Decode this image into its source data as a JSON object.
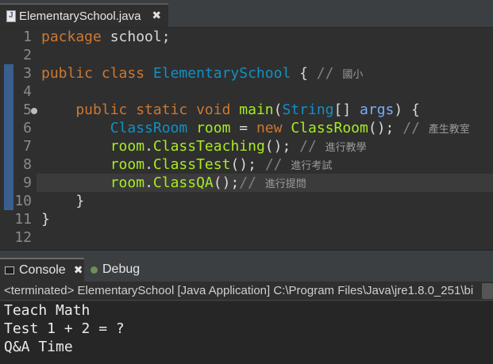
{
  "editor_tab": {
    "title": "ElementarySchool.java",
    "close": "✖"
  },
  "editor": {
    "line_numbers": [
      "1",
      "2",
      "3",
      "4",
      "5",
      "6",
      "7",
      "8",
      "9",
      "10",
      "11",
      "12"
    ],
    "lines": [
      {
        "tokens": [
          {
            "t": "package ",
            "c": "kw"
          },
          {
            "t": "school;",
            "c": "pl"
          }
        ]
      },
      {
        "tokens": []
      },
      {
        "tokens": [
          {
            "t": "public ",
            "c": "kw"
          },
          {
            "t": "class ",
            "c": "kw"
          },
          {
            "t": "ElementarySchool",
            "c": "cls"
          },
          {
            "t": " { ",
            "c": "pl"
          },
          {
            "t": "// ",
            "c": "cm"
          },
          {
            "t": "國小",
            "c": "cjk"
          }
        ]
      },
      {
        "tokens": []
      },
      {
        "tokens": [
          {
            "t": "    public ",
            "c": "kw"
          },
          {
            "t": "static ",
            "c": "kw"
          },
          {
            "t": "void ",
            "c": "kw"
          },
          {
            "t": "main",
            "c": "fn"
          },
          {
            "t": "(",
            "c": "pl"
          },
          {
            "t": "String",
            "c": "cls"
          },
          {
            "t": "[] ",
            "c": "pl"
          },
          {
            "t": "args",
            "c": "var"
          },
          {
            "t": ") {",
            "c": "pl"
          }
        ]
      },
      {
        "tokens": [
          {
            "t": "        ",
            "c": "pl"
          },
          {
            "t": "ClassRoom",
            "c": "cls"
          },
          {
            "t": " ",
            "c": "pl"
          },
          {
            "t": "room",
            "c": "fn"
          },
          {
            "t": " = ",
            "c": "pl"
          },
          {
            "t": "new ",
            "c": "kw"
          },
          {
            "t": "ClassRoom",
            "c": "fn"
          },
          {
            "t": "(); ",
            "c": "pl"
          },
          {
            "t": "// ",
            "c": "cm"
          },
          {
            "t": "產生教室",
            "c": "cjk"
          }
        ]
      },
      {
        "tokens": [
          {
            "t": "        ",
            "c": "pl"
          },
          {
            "t": "room",
            "c": "fn"
          },
          {
            "t": ".",
            "c": "pl"
          },
          {
            "t": "ClassTeaching",
            "c": "fn"
          },
          {
            "t": "(); ",
            "c": "pl"
          },
          {
            "t": "// ",
            "c": "cm"
          },
          {
            "t": "進行教學",
            "c": "cjk"
          }
        ]
      },
      {
        "tokens": [
          {
            "t": "        ",
            "c": "pl"
          },
          {
            "t": "room",
            "c": "fn"
          },
          {
            "t": ".",
            "c": "pl"
          },
          {
            "t": "ClassTest",
            "c": "fn"
          },
          {
            "t": "(); ",
            "c": "pl"
          },
          {
            "t": "// ",
            "c": "cm"
          },
          {
            "t": "進行考試",
            "c": "cjk"
          }
        ]
      },
      {
        "tokens": [
          {
            "t": "        ",
            "c": "pl"
          },
          {
            "t": "room",
            "c": "fn"
          },
          {
            "t": ".",
            "c": "pl"
          },
          {
            "t": "ClassQA",
            "c": "fn"
          },
          {
            "t": "();",
            "c": "pl"
          },
          {
            "t": "// ",
            "c": "cm"
          },
          {
            "t": "進行提問",
            "c": "cjk"
          }
        ]
      },
      {
        "tokens": [
          {
            "t": "    }",
            "c": "pl"
          }
        ]
      },
      {
        "tokens": [
          {
            "t": "}",
            "c": "pl"
          }
        ]
      },
      {
        "tokens": []
      }
    ]
  },
  "console_tabs": {
    "console_label": "Console",
    "console_close": "✖",
    "debug_label": "Debug"
  },
  "console": {
    "description": "<terminated> ElementarySchool [Java Application] C:\\Program Files\\Java\\jre1.8.0_251\\bi",
    "output": [
      "Teach Math",
      "Test 1 + 2 = ?",
      "Q&A Time"
    ]
  },
  "colors": {
    "keyword": "#cc7832",
    "class_name": "#1290c3",
    "method": "#a7ec21",
    "parameter": "#79abff",
    "comment": "#808080",
    "background": "#2f2f2f"
  }
}
